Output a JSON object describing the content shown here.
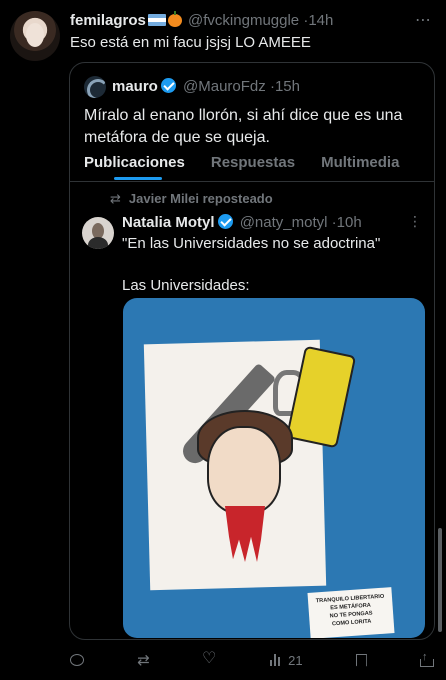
{
  "tweet": {
    "author_name": "femilagros",
    "author_handle": "@fvckingmuggle",
    "separator": "·",
    "time": "14h",
    "text": "Eso está en mi facu jsjsj LO AMEEE"
  },
  "quote": {
    "author_name": "mauro",
    "author_handle": "@MauroFdz",
    "separator": "·",
    "time": "15h",
    "text": "Míralo al enano llorón, si ahí dice que es una metáfora de que se queja.",
    "tabs": [
      {
        "label": "Publicaciones",
        "active": true
      },
      {
        "label": "Respuestas",
        "active": false
      },
      {
        "label": "Multimedia",
        "active": false
      }
    ],
    "reposted_by": "Javier Milei reposteado",
    "inner_post": {
      "author_name": "Natalia Motyl",
      "author_handle": "@naty_motyl",
      "separator": "·",
      "time": "10h",
      "text_line1": "\"En las Universidades no se adoctrina\"",
      "text_line2": "Las Universidades:",
      "image_note": [
        "TRANQUILO LIBERTARIO",
        "ES METÁFORA",
        "NO TE PONGAS",
        "COMO LORITA"
      ]
    }
  },
  "actions": {
    "views_count": "21"
  },
  "icons": {
    "verified": "verified-badge-icon",
    "more": "more-icon",
    "repost": "repost-icon",
    "reply": "reply-icon",
    "like": "like-icon",
    "views": "views-icon",
    "bookmark": "bookmark-icon",
    "share": "share-icon"
  },
  "colors": {
    "background": "#000000",
    "text": "#e7e9ea",
    "muted": "#71767b",
    "accent": "#1d9bf0",
    "border": "#2f3336"
  }
}
